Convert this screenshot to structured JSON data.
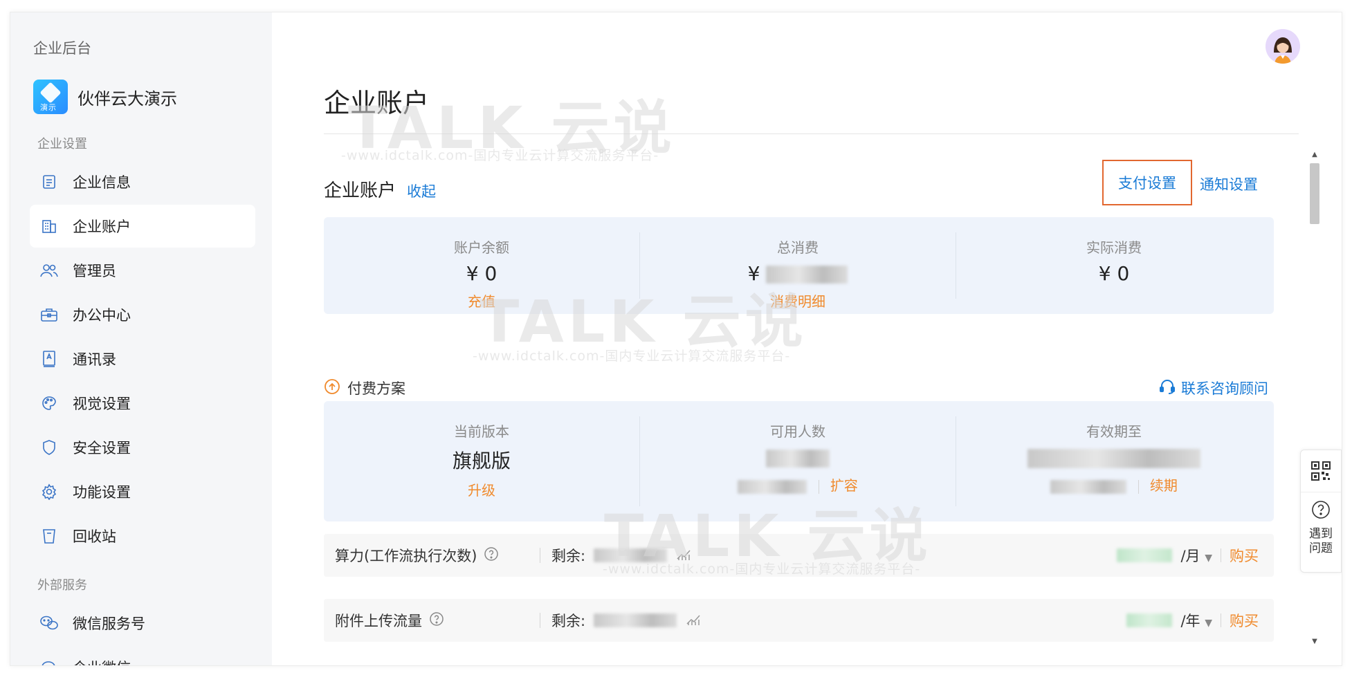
{
  "sidebar": {
    "top_title": "企业后台",
    "org_name": "伙伴云大演示",
    "org_logo_tag": "演示",
    "group_settings": "企业设置",
    "items": [
      {
        "label": "企业信息",
        "icon": "document-icon"
      },
      {
        "label": "企业账户",
        "icon": "building-icon",
        "active": true
      },
      {
        "label": "管理员",
        "icon": "users-icon"
      },
      {
        "label": "办公中心",
        "icon": "briefcase-icon"
      },
      {
        "label": "通讯录",
        "icon": "contacts-icon"
      },
      {
        "label": "视觉设置",
        "icon": "palette-icon"
      },
      {
        "label": "安全设置",
        "icon": "shield-icon"
      },
      {
        "label": "功能设置",
        "icon": "gear-icon"
      },
      {
        "label": "回收站",
        "icon": "trash-icon"
      }
    ],
    "group_external": "外部服务",
    "external_items": [
      {
        "label": "微信服务号",
        "icon": "wechat-icon"
      },
      {
        "label": "企业微信",
        "icon": "wecom-icon"
      }
    ]
  },
  "main": {
    "page_title": "企业账户",
    "section_title": "企业账户",
    "collapse_label": "收起",
    "pay_settings": "支付设置",
    "notify_settings": "通知设置",
    "account": {
      "balance_label": "账户余额",
      "balance_value": "¥ 0",
      "recharge": "充值",
      "total_label": "总消费",
      "total_prefix": "¥",
      "detail": "消费明细",
      "actual_label": "实际消费",
      "actual_value": "¥ 0"
    },
    "plan_title": "付费方案",
    "consult": "联系咨询顾问",
    "plan": {
      "version_label": "当前版本",
      "version_value": "旗舰版",
      "upgrade": "升级",
      "users_label": "可用人数",
      "expand": "扩容",
      "expiry_label": "有效期至",
      "renew": "续期"
    },
    "rows": [
      {
        "name": "算力(工作流执行次数)",
        "remain_label": "剩余:",
        "unit": "/月",
        "buy": "购买"
      },
      {
        "name": "附件上传流量",
        "remain_label": "剩余:",
        "unit": "/年",
        "buy": "购买"
      }
    ]
  },
  "watermark": {
    "brand": "TALK 云说",
    "url": "-www.idctalk.com-国内专业云计算交流服务平台-"
  },
  "float": {
    "help": "遇到问题"
  },
  "colors": {
    "link": "#1a7bd6",
    "accent_orange": "#f08a2c",
    "highlight_box": "#e2672f",
    "panel_bg": "#eef3fb"
  }
}
